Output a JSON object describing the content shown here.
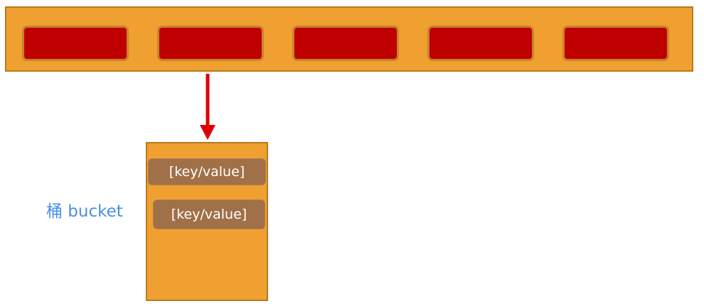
{
  "bucket": {
    "label": "桶 bucket",
    "entries": [
      "[key/value]",
      "[key/value]"
    ]
  },
  "colors": {
    "container_fill": "#f0a030",
    "container_border": "#b87a1c",
    "slot_fill": "#c00000",
    "entry_fill": "#a07048",
    "arrow": "#e00000",
    "label_text": "#4a8ee8"
  }
}
